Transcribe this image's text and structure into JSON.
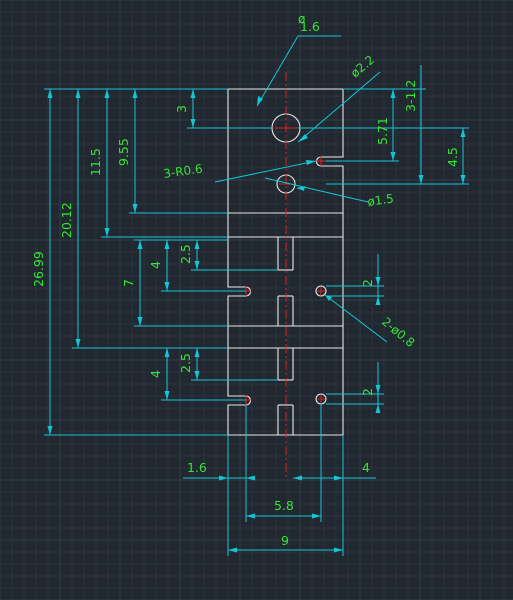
{
  "drawing": {
    "background": "#212830",
    "dimension_text_color": "#33e633",
    "dimension_line_color": "#12c6d6",
    "part_outline_color": "#e8e8e8",
    "centerline_color": "#e02020"
  },
  "dimensions": {
    "thickness": "1.6",
    "hole_large": "ø2.2",
    "hole_small": "ø1.5",
    "holes_tiny": "2-ø0.8",
    "radius_notches": "3-R0.6",
    "top_offset": "3",
    "width_notch_x": "5.71",
    "notch_spacing_top": "3-1.2",
    "notch_offset": "4.5",
    "overall_height": "26.99",
    "height_20_12": "20.12",
    "height_11_5": "11.5",
    "height_9_55": "9.55",
    "slot_2_5_a": "2.5",
    "slot_4_a": "4",
    "slot_2_a": "2",
    "pitch_7": "7",
    "slot_2_5_b": "2.5",
    "slot_4_b": "4",
    "slot_2_b": "2",
    "left_offset": "1.6",
    "right_offset": "4",
    "hole_spacing": "5.8",
    "overall_width": "9"
  }
}
